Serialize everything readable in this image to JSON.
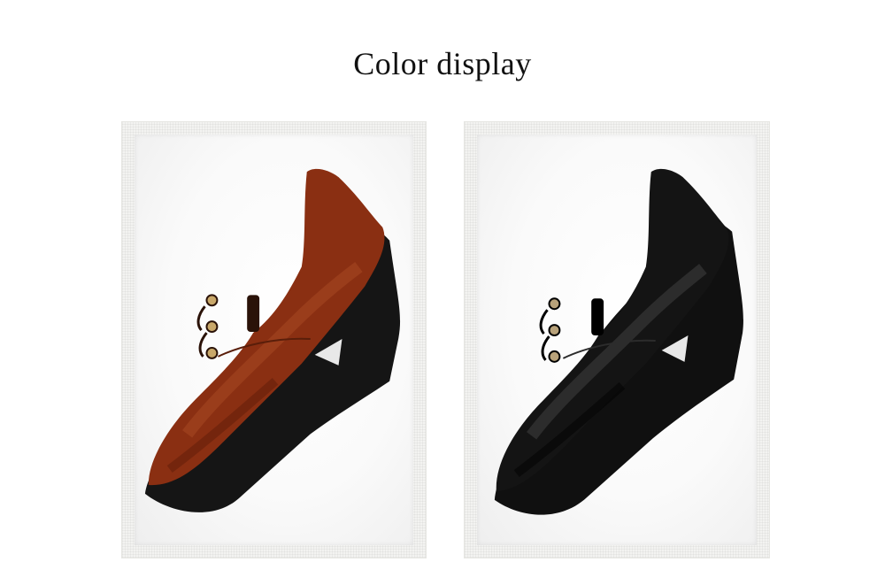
{
  "page": {
    "title": "Color display"
  },
  "products": [
    {
      "name": "brown-shoe",
      "color": "#8a2f12",
      "highlight": "#b85a2e",
      "shadow": "#4a1506"
    },
    {
      "name": "black-shoe",
      "color": "#141414",
      "highlight": "#4a4a4a",
      "shadow": "#000000"
    }
  ],
  "colors": {
    "background": "#ffffff",
    "frame": "#f3f3f1",
    "sole": "#151515",
    "eyelet": "#c9a86a",
    "title": "#111111"
  }
}
